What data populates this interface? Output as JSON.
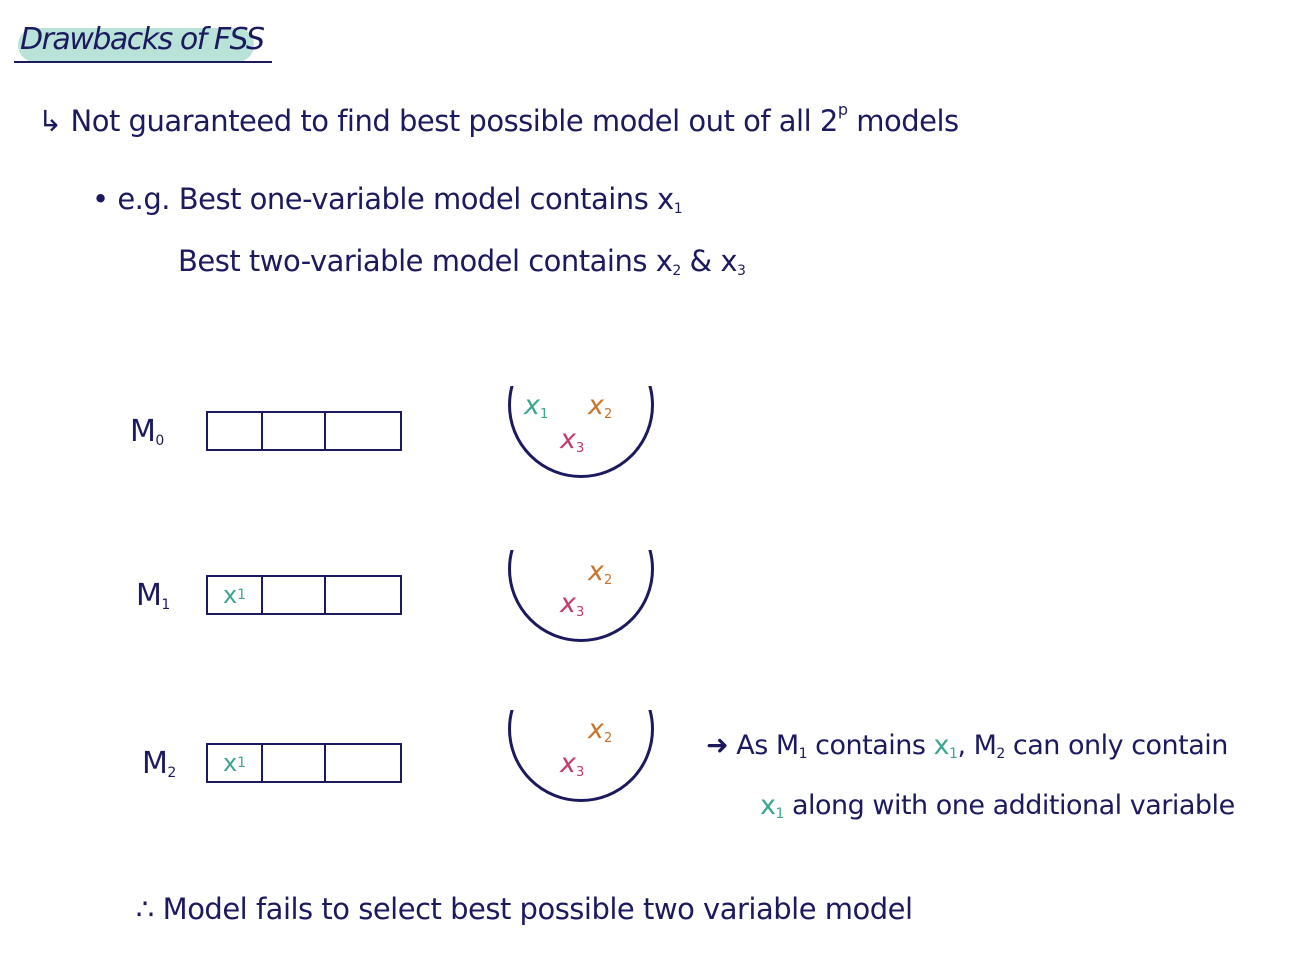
{
  "title": "Drawbacks of FSS",
  "drawback": {
    "arrow": "↳",
    "text_before": "Not guaranteed to find best possible model out of all 2",
    "superscript": "p",
    "text_after": " models"
  },
  "example": {
    "bullet": "•",
    "prefix": "e.g.",
    "line1_text": "Best one-variable model contains x",
    "line1_sub": "1",
    "line2_text": "Best two-variable model contains x",
    "line2_sub_a": "2",
    "line2_amp": " & x",
    "line2_sub_b": "3"
  },
  "models": [
    {
      "label": "M0",
      "label_main": "M",
      "label_sub": "0",
      "box_cells": [
        "",
        "",
        ""
      ],
      "pool": [
        "x1",
        "x2",
        "x3"
      ]
    },
    {
      "label": "M1",
      "label_main": "M",
      "label_sub": "1",
      "box_cells": [
        "x1",
        "",
        ""
      ],
      "pool": [
        "x2",
        "x3"
      ]
    },
    {
      "label": "M2",
      "label_main": "M",
      "label_sub": "2",
      "box_cells": [
        "x1",
        "",
        ""
      ],
      "pool": [
        "x2",
        "x3"
      ]
    }
  ],
  "note": {
    "arrow": "➜",
    "line1_a": "As M",
    "line1_sub_m": "1",
    "line1_b": " contains ",
    "line1_x": "x",
    "line1_x_sub": "1",
    "line1_c": ", M",
    "line1_sub_m2": "2",
    "line1_d": " can only contain",
    "line2_x": "x",
    "line2_x_sub": "1",
    "line2_rest": " along with one additional variable"
  },
  "conclusion": {
    "therefore": "∴",
    "text": " Model fails to select best possible two variable model"
  },
  "colors": {
    "ink": "#1c1a5e",
    "x1": "#3aa68f",
    "x2": "#c8742a",
    "x3": "#c43b6e",
    "highlight": "#b9e3d8"
  }
}
